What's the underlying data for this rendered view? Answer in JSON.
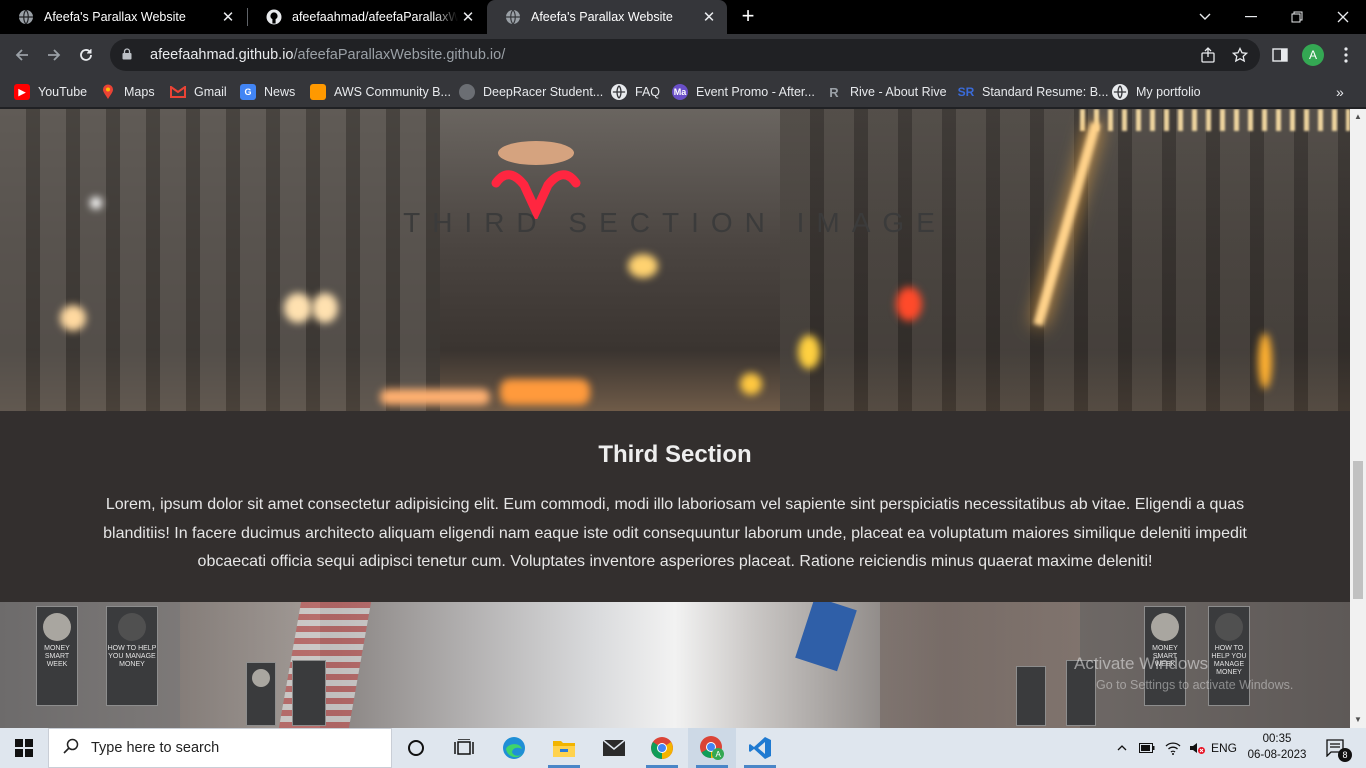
{
  "browser": {
    "tabs": [
      {
        "title": "Afeefa's Parallax Website",
        "icon": "globe-icon",
        "active": false
      },
      {
        "title": "afeefaahmad/afeefaParallaxWebsite",
        "icon": "github-icon",
        "active": false
      },
      {
        "title": "Afeefa's Parallax Website",
        "icon": "globe-icon",
        "active": true
      }
    ],
    "new_tab_label": "+",
    "url_domain": "afeefaahmad.github.io",
    "url_path": "/afeefaParallaxWebsite.github.io/",
    "profile_initial": "A",
    "bookmarks": [
      {
        "label": "YouTube",
        "icon": "youtube-icon",
        "color": "#ff0000"
      },
      {
        "label": "Maps",
        "icon": "maps-icon",
        "color": "#34a853"
      },
      {
        "label": "Gmail",
        "icon": "gmail-icon",
        "color": "#ea4335"
      },
      {
        "label": "News",
        "icon": "news-icon",
        "color": "#4285f4"
      },
      {
        "label": "AWS Community B...",
        "icon": "aws-icon",
        "color": "#ff9900"
      },
      {
        "label": "DeepRacer Student...",
        "icon": "deepracer-icon",
        "color": "#9aa0a6"
      },
      {
        "label": "FAQ",
        "icon": "globe-icon",
        "color": "#e8eaed"
      },
      {
        "label": "Event Promo - After...",
        "icon": "meetup-icon",
        "color": "#6a4fc8"
      },
      {
        "label": "Rive - About Rive",
        "icon": "rive-icon",
        "color": "#9aa0a6"
      },
      {
        "label": "Standard Resume: B...",
        "icon": "sr-icon",
        "color": "#3a6bd8"
      },
      {
        "label": "My portfolio",
        "icon": "globe-icon",
        "color": "#e8eaed"
      }
    ]
  },
  "page": {
    "hero_title": "THIRD SECTION IMAGE",
    "section_heading": "Third Section",
    "section_body": "Lorem, ipsum dolor sit amet consectetur adipisicing elit. Eum commodi, modi illo laboriosam vel sapiente sint perspiciatis necessitatibus ab vitae. Eligendi a quas blanditiis! In facere ducimus architecto aliquam eligendi nam eaque iste odit consequuntur laborum unde, placeat ea voluptatum maiores similique deleniti impedit obcaecati officia sequi adipisci tenetur cum. Voluptates inventore asperiores placeat. Ratione reiciendis minus quaerat maxime deleniti!",
    "watermark_line1": "Activate Windows",
    "watermark_line2": "Go to Settings to activate Windows."
  },
  "taskbar": {
    "search_placeholder": "Type here to search",
    "language": "ENG",
    "time": "00:35",
    "date": "06-08-2023",
    "notification_count": "8"
  }
}
